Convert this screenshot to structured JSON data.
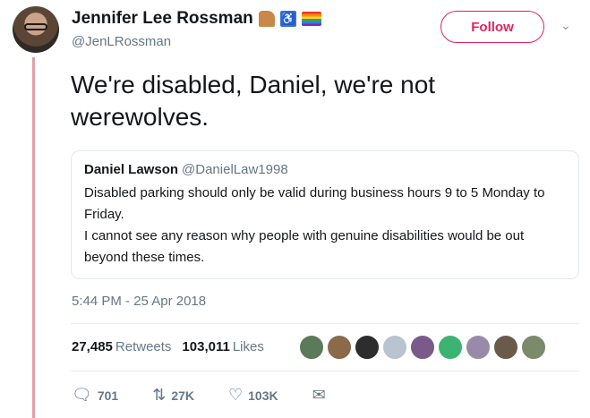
{
  "author": {
    "name": "Jennifer Lee Rossman",
    "handle": "@JenLRossman",
    "name_emojis": [
      "dinosaur-icon",
      "wheelchair-icon",
      "rainbow-flag-icon"
    ]
  },
  "follow_label": "Follow",
  "tweet_text": "We're disabled, Daniel, we're not werewolves.",
  "quoted": {
    "name": "Daniel Lawson",
    "handle": "@DanielLaw1998",
    "line1": "Disabled parking should only be valid during business hours 9 to 5 Monday to Friday.",
    "line2": "I cannot see any reason why people with genuine disabilities would be out beyond these times."
  },
  "timestamp": "5:44 PM - 25 Apr 2018",
  "stats": {
    "retweets_count": "27,485",
    "retweets_label": "Retweets",
    "likes_count": "103,011",
    "likes_label": "Likes"
  },
  "liker_avatar_colors": [
    "#5a7a5a",
    "#8a6a4a",
    "#2d2d2d",
    "#b8c4cf",
    "#7a5a8a",
    "#3cb371",
    "#9a8aaa",
    "#6a5a4a",
    "#7a8a6a"
  ],
  "actions": {
    "replies": "701",
    "retweets": "27K",
    "likes": "103K"
  },
  "colors": {
    "accent": "#e0245e",
    "secondary_text": "#657786"
  }
}
